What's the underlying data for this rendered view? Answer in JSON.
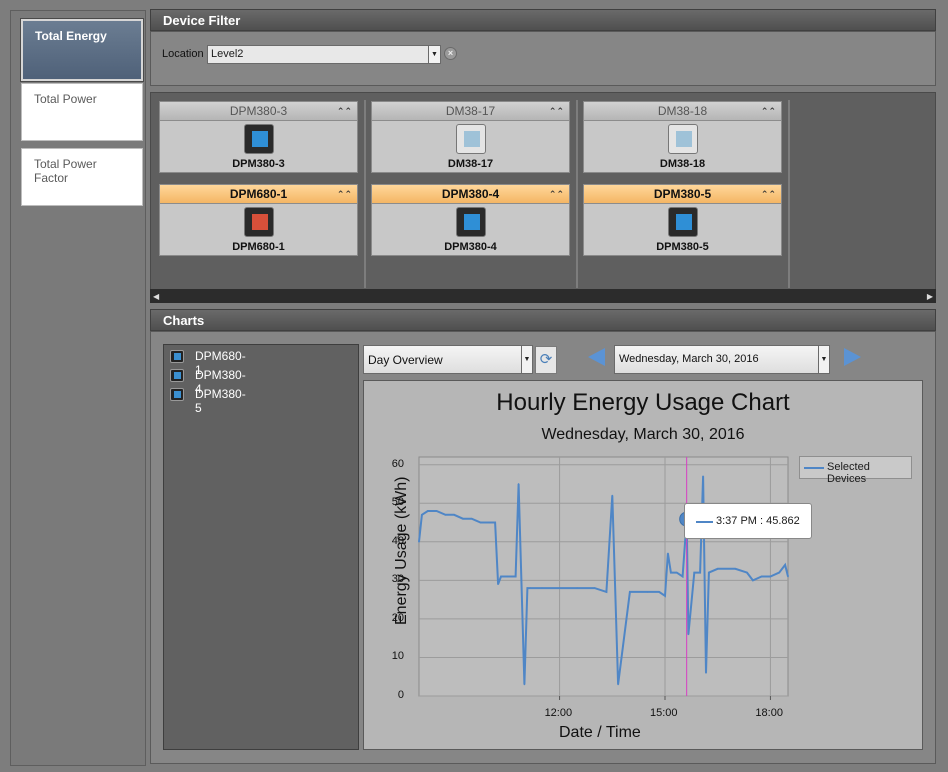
{
  "nav": {
    "items": [
      {
        "label": "Total Energy",
        "active": true
      },
      {
        "label": "Total Power",
        "active": false
      },
      {
        "label": "Total Power Factor",
        "active": false
      }
    ]
  },
  "device_filter": {
    "title": "Device Filter",
    "location_label": "Location",
    "location_value": "Level2"
  },
  "devices": {
    "columns": [
      [
        {
          "header": "DPM380-3",
          "name": "DPM380-3",
          "selected": false,
          "icon": "meter-icon-blue"
        },
        {
          "header": "DPM680-1",
          "name": "DPM680-1",
          "selected": true,
          "icon": "meter-icon-color"
        }
      ],
      [
        {
          "header": "DM38-17",
          "name": "DM38-17",
          "selected": false,
          "icon": "din-meter-icon"
        },
        {
          "header": "DPM380-4",
          "name": "DPM380-4",
          "selected": true,
          "icon": "meter-icon-blue"
        }
      ],
      [
        {
          "header": "DM38-18",
          "name": "DM38-18",
          "selected": false,
          "icon": "din-meter-icon"
        },
        {
          "header": "DPM380-5",
          "name": "DPM380-5",
          "selected": true,
          "icon": "meter-icon-blue"
        }
      ]
    ]
  },
  "charts": {
    "title": "Charts",
    "device_list": [
      "DPM680-1",
      "DPM380-4",
      "DPM380-5"
    ],
    "view_select": "Day Overview",
    "date_select": "Wednesday, March 30, 2016",
    "tooltip": "3:37 PM : 45.862"
  },
  "colors": {
    "series": "#4f86c6",
    "cursor": "#d63fc4",
    "selected_header": "#f4b664",
    "nav_active": "#5b6d84"
  },
  "chart_data": {
    "type": "line",
    "title": "Hourly Energy Usage Chart",
    "subtitle": "Wednesday, March 30, 2016",
    "xlabel": "Date / Time",
    "ylabel": "Energy Usage (kWh)",
    "ylim": [
      0,
      62
    ],
    "xlim": [
      "08:00",
      "18:30"
    ],
    "yticks": [
      0,
      10,
      20,
      30,
      40,
      50,
      60
    ],
    "xticks": [
      "12:00",
      "15:00",
      "18:00"
    ],
    "legend": {
      "entries": [
        "Selected Devices"
      ],
      "position": "top-right"
    },
    "grid": true,
    "series": [
      {
        "name": "Selected Devices",
        "x": [
          "08:00",
          "08:05",
          "08:15",
          "08:30",
          "08:45",
          "09:00",
          "09:15",
          "09:30",
          "09:45",
          "10:00",
          "10:10",
          "10:15",
          "10:20",
          "10:30",
          "10:40",
          "10:45",
          "10:50",
          "11:00",
          "11:05",
          "11:10",
          "11:30",
          "12:00",
          "12:30",
          "13:00",
          "13:20",
          "13:30",
          "13:40",
          "14:00",
          "14:30",
          "14:50",
          "15:00",
          "15:05",
          "15:10",
          "15:20",
          "15:30",
          "15:37",
          "15:40",
          "15:50",
          "16:00",
          "16:05",
          "16:10",
          "16:15",
          "16:30",
          "17:00",
          "17:20",
          "17:30",
          "17:45",
          "18:00",
          "18:15",
          "18:25",
          "18:30"
        ],
        "y": [
          40,
          47,
          48,
          48,
          47,
          47,
          46,
          46,
          45,
          45,
          45,
          29,
          31,
          31,
          31,
          31,
          55,
          3,
          28,
          28,
          28,
          28,
          28,
          28,
          27,
          52,
          3,
          27,
          27,
          27,
          26,
          37,
          32,
          32,
          31,
          45.9,
          16,
          32,
          32,
          57,
          6,
          32,
          33,
          33,
          32,
          30,
          31,
          31,
          32,
          34,
          31
        ]
      }
    ]
  }
}
